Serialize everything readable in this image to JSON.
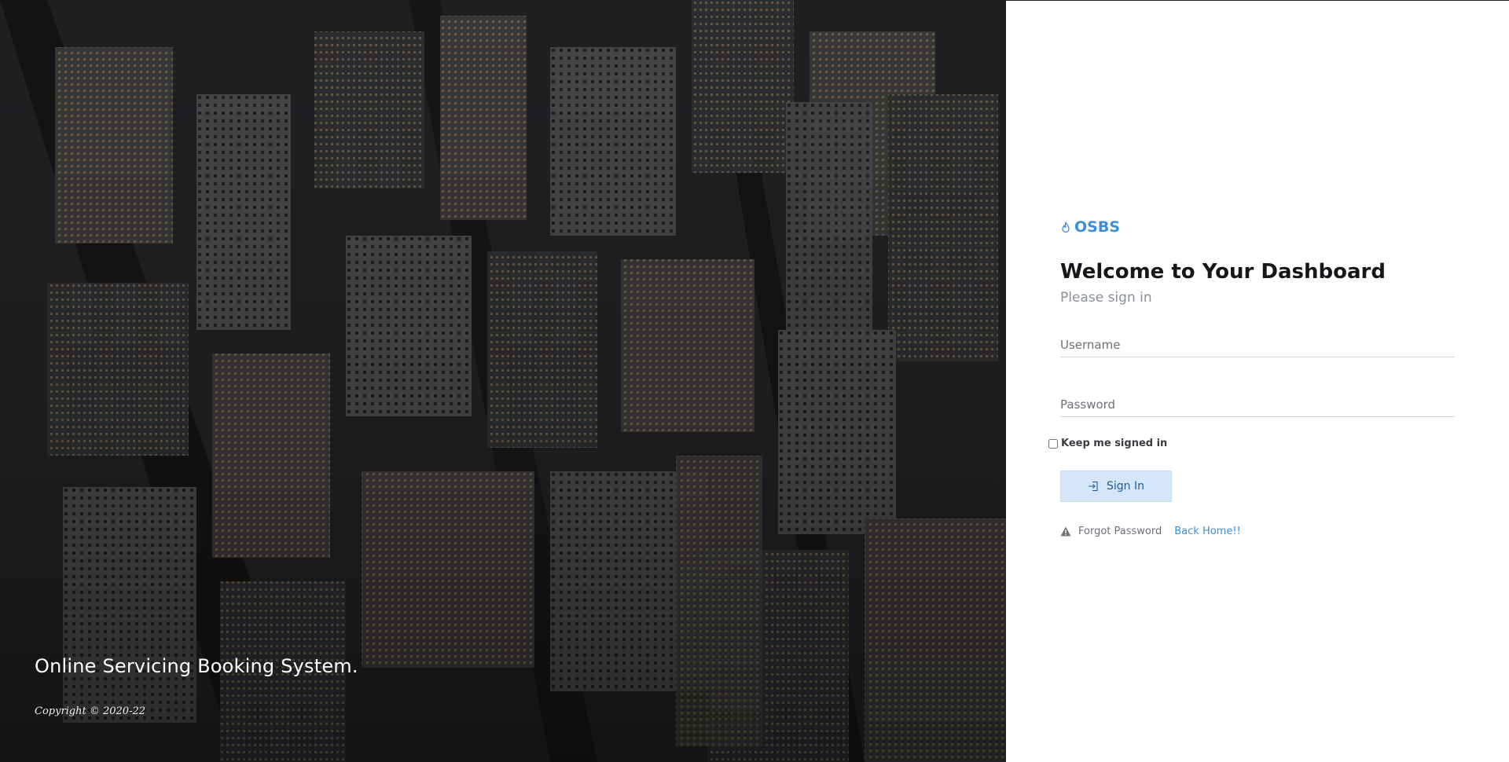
{
  "hero": {
    "tagline": "Online Servicing Booking System.",
    "copyright": "Copyright © 2020-22"
  },
  "login": {
    "brand": "OSBS",
    "brand_icon": "fire-icon",
    "heading": "Welcome to Your Dashboard",
    "subheading": "Please sign in",
    "username_placeholder": "Username",
    "username_value": "",
    "password_placeholder": "Password",
    "password_value": "",
    "remember_label": "Keep me signed in",
    "remember_checked": false,
    "signin_label": "Sign In",
    "signin_icon": "sign-in-icon",
    "forgot_label": "Forgot Password",
    "forgot_icon": "warning-icon",
    "home_label": "Back Home!!"
  },
  "colors": {
    "accent": "#3b8fd9",
    "button_bg": "#d4e6f8",
    "heading": "#15171a",
    "muted": "#8a9099"
  }
}
